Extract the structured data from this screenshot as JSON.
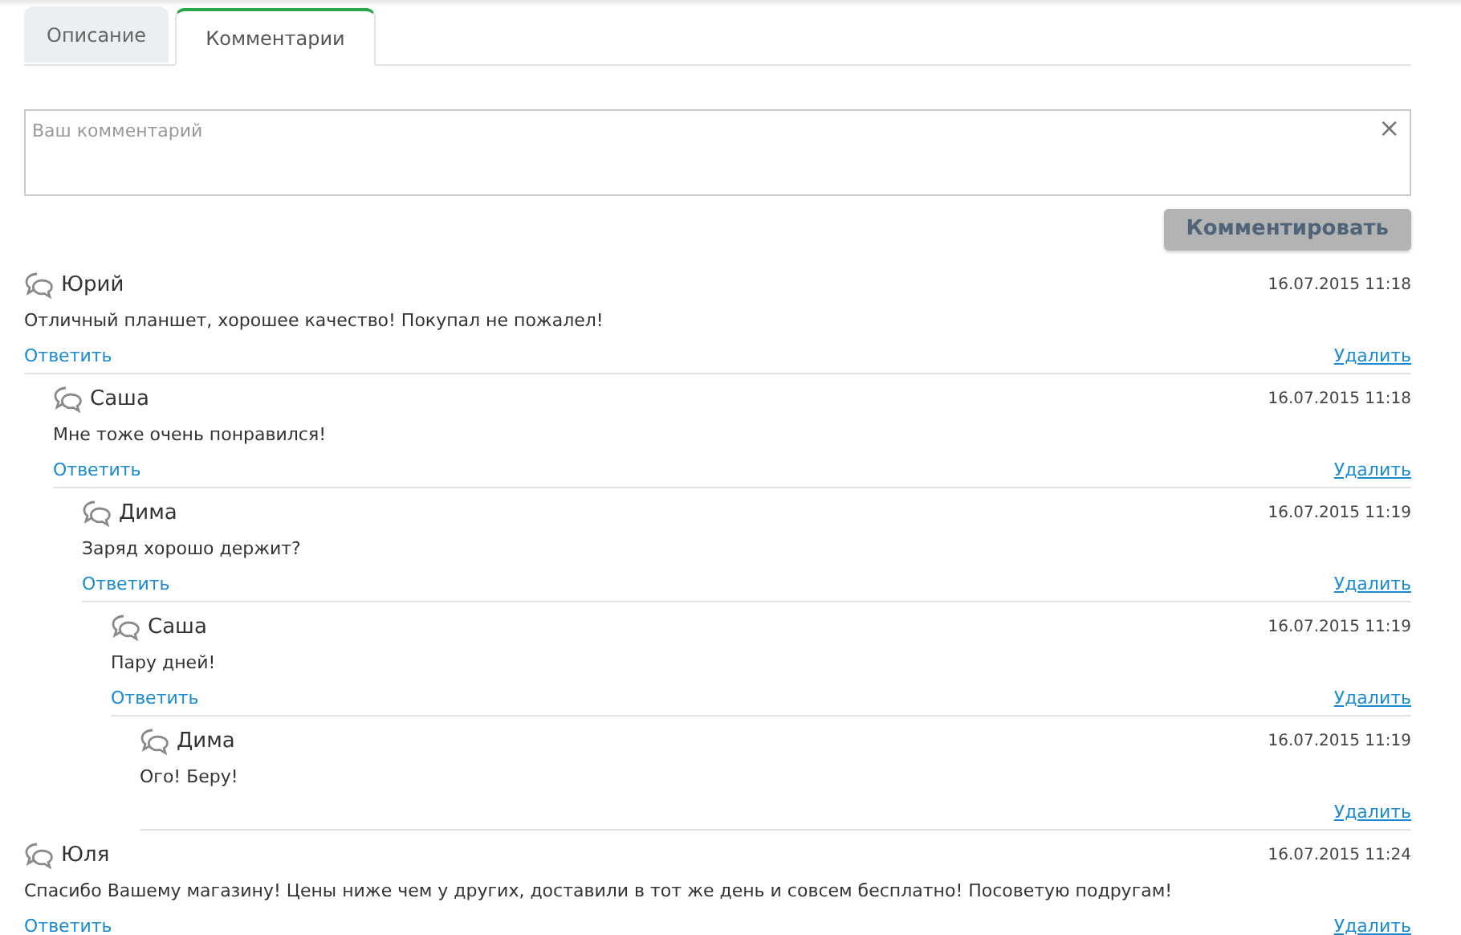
{
  "tabs": [
    {
      "label": "Описание",
      "selected": false
    },
    {
      "label": "Комментарии",
      "selected": true
    }
  ],
  "comment_form": {
    "placeholder": "Ваш комментарий",
    "clear_icon": "×",
    "submit": "Комментировать"
  },
  "comments": [
    {
      "author": "Юрий",
      "date": "16.07.2015 11:18",
      "text": "Отличный планшет, хорошее качество! Покупал не пожалел!",
      "reply": "Ответить",
      "delete": "Удалить",
      "children": [
        {
          "author": "Саша",
          "date": "16.07.2015 11:18",
          "text": "Мне тоже очень понравился!",
          "reply": "Ответить",
          "delete": "Удалить",
          "children": [
            {
              "author": "Дима",
              "date": "16.07.2015 11:19",
              "text": "Заряд хорошо держит?",
              "reply": "Ответить",
              "delete": "Удалить",
              "children": [
                {
                  "author": "Саша",
                  "date": "16.07.2015 11:19",
                  "text": "Пару дней!",
                  "reply": "Ответить",
                  "delete": "Удалить",
                  "children": [
                    {
                      "author": "Дима",
                      "date": "16.07.2015 11:19",
                      "text": "Ого! Беру!",
                      "delete": "Удалить"
                    }
                  ]
                }
              ]
            }
          ]
        }
      ]
    },
    {
      "author": "Юля",
      "date": "16.07.2015 11:24",
      "text": "Спасибо Вашему магазину! Цены ниже чем у других, доставили в тот же день и совсем бесплатно! Посоветую подругам!",
      "reply": "Ответить",
      "delete": "Удалить"
    }
  ]
}
